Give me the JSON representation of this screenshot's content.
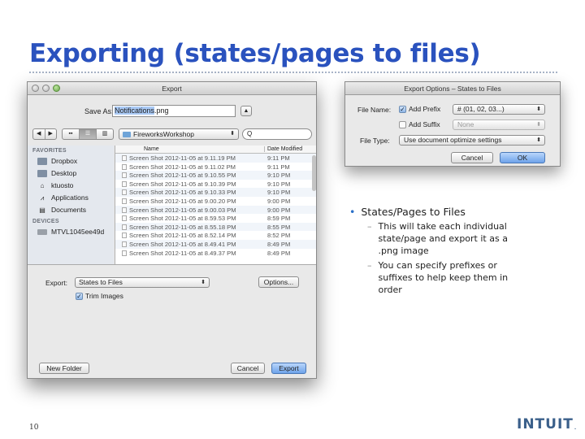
{
  "slide": {
    "title": "Exporting (states/pages to files)",
    "page_number": "10",
    "logo": "INTUIT",
    "logo_mark": ".",
    "accent_color": "#2a52be"
  },
  "export_dialog": {
    "title": "Export",
    "save_as_label": "Save As:",
    "filename_selected": "Notifications",
    "filename_ext": ".png",
    "folder": "FireworksWorkshop",
    "search_placeholder": "Q",
    "sidebar": {
      "favorites_header": "FAVORITES",
      "favorites": [
        {
          "label": "Dropbox",
          "icon": "folder-icon"
        },
        {
          "label": "Desktop",
          "icon": "desktop-icon"
        },
        {
          "label": "ktuosto",
          "icon": "home-icon"
        },
        {
          "label": "Applications",
          "icon": "applications-icon"
        },
        {
          "label": "Documents",
          "icon": "documents-icon"
        }
      ],
      "devices_header": "DEVICES",
      "devices": [
        {
          "label": "MTVL1045ee49d",
          "icon": "drive-icon"
        }
      ]
    },
    "file_list": {
      "col_name": "Name",
      "col_date": "Date Modified",
      "rows": [
        {
          "name": "Screen Shot 2012-11-05 at 9.11.19 PM",
          "date": "9:11 PM"
        },
        {
          "name": "Screen Shot 2012-11-05 at 9.11.02 PM",
          "date": "9:11 PM"
        },
        {
          "name": "Screen Shot 2012-11-05 at 9.10.55 PM",
          "date": "9:10 PM"
        },
        {
          "name": "Screen Shot 2012-11-05 at 9.10.39 PM",
          "date": "9:10 PM"
        },
        {
          "name": "Screen Shot 2012-11-05 at 9.10.33 PM",
          "date": "9:10 PM"
        },
        {
          "name": "Screen Shot 2012-11-05 at 9.00.20 PM",
          "date": "9:00 PM"
        },
        {
          "name": "Screen Shot 2012-11-05 at 9.00.03 PM",
          "date": "9:00 PM"
        },
        {
          "name": "Screen Shot 2012-11-05 at 8.59.53 PM",
          "date": "8:59 PM"
        },
        {
          "name": "Screen Shot 2012-11-05 at 8.55.18 PM",
          "date": "8:55 PM"
        },
        {
          "name": "Screen Shot 2012-11-05 at 8.52.14 PM",
          "date": "8:52 PM"
        },
        {
          "name": "Screen Shot 2012-11-05 at 8.49.41 PM",
          "date": "8:49 PM"
        },
        {
          "name": "Screen Shot 2012-11-05 at 8.49.37 PM",
          "date": "8:49 PM"
        }
      ]
    },
    "export_label": "Export:",
    "export_value": "States to Files",
    "options_button": "Options...",
    "trim_images_label": "Trim Images",
    "trim_images_checked": true,
    "new_folder_button": "New Folder",
    "cancel_button": "Cancel",
    "export_button": "Export"
  },
  "options_dialog": {
    "title": "Export Options – States to Files",
    "file_name_label": "File Name:",
    "add_prefix_label": "Add Prefix",
    "add_prefix_checked": true,
    "prefix_value": "# (01, 02, 03...)",
    "add_suffix_label": "Add Suffix",
    "add_suffix_checked": false,
    "suffix_value": "None",
    "file_type_label": "File Type:",
    "file_type_value": "Use document optimize settings",
    "cancel_button": "Cancel",
    "ok_button": "OK"
  },
  "bullets": {
    "main": "States/Pages to Files",
    "subs": [
      "This will take each individual state/page and export it as a .png image",
      "You can specify prefixes or suffixes to help keep them in order"
    ]
  }
}
